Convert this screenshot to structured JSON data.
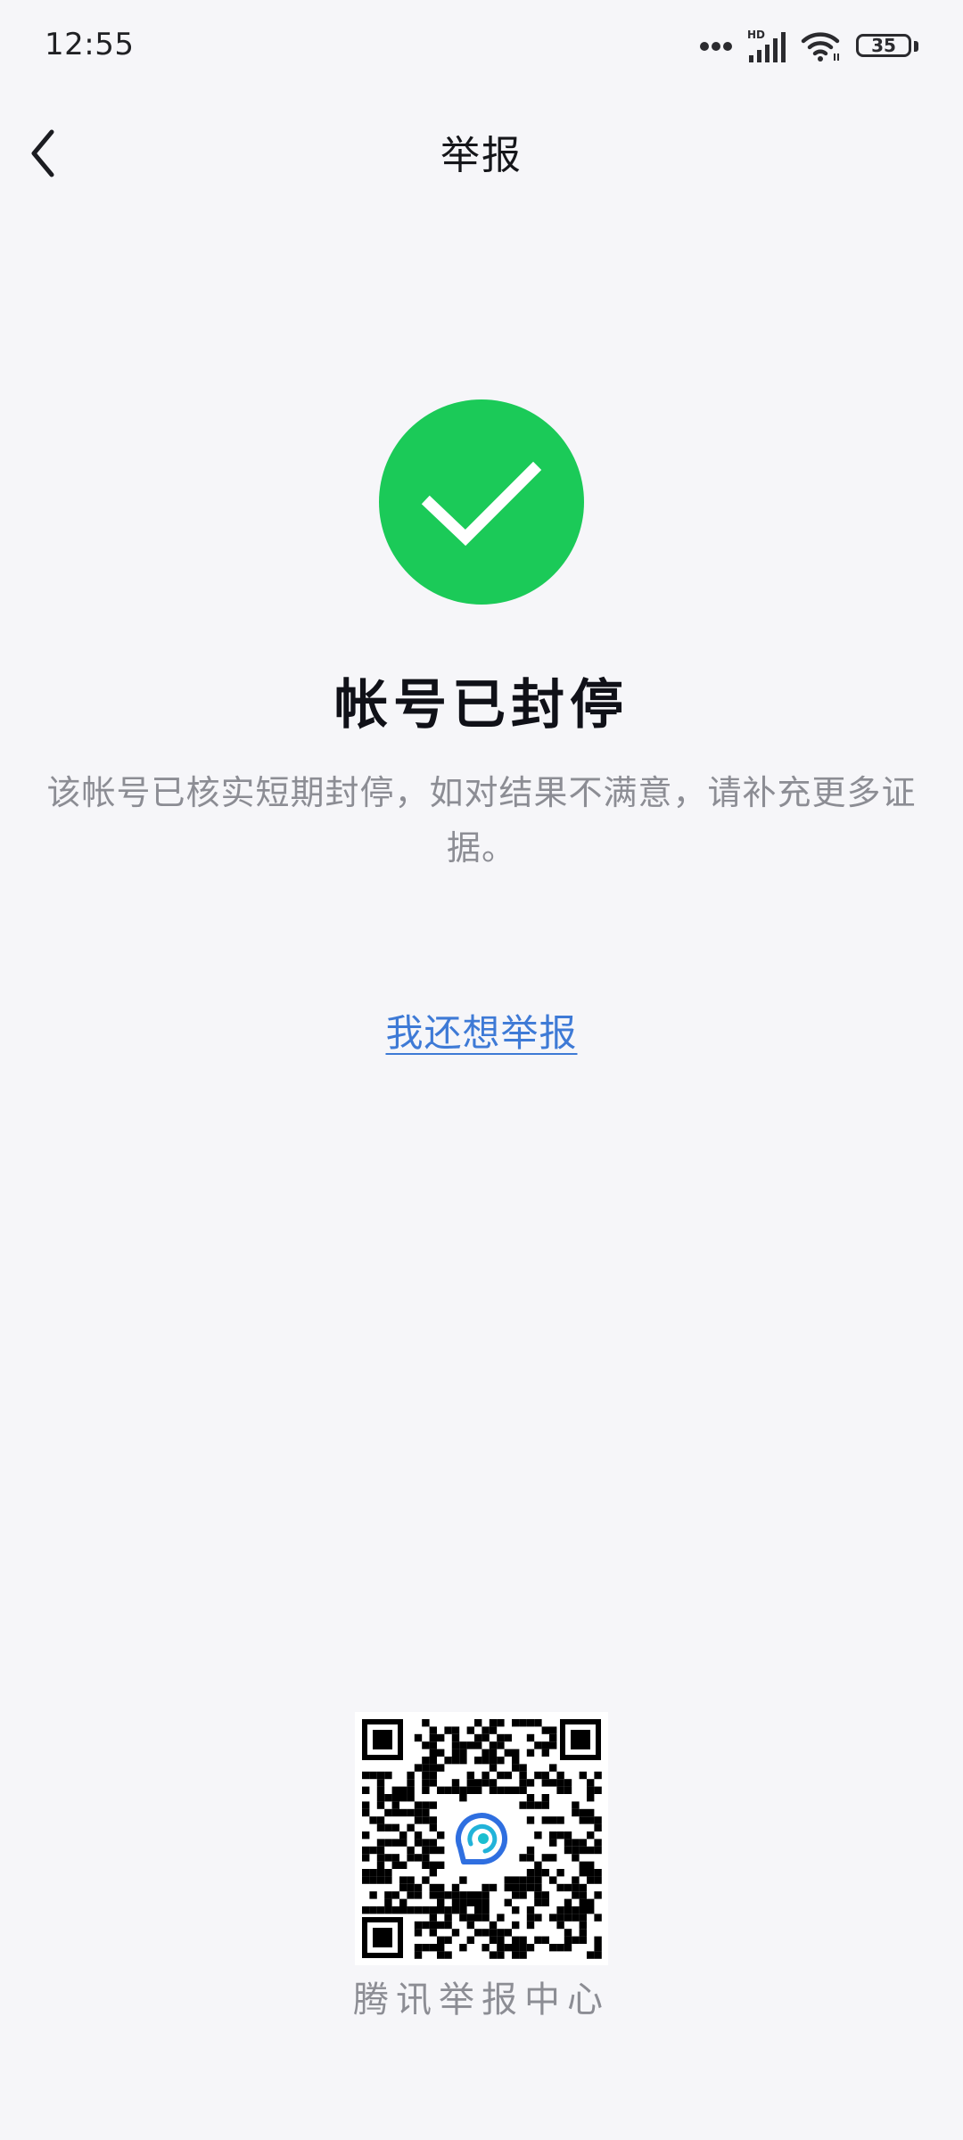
{
  "status_bar": {
    "time": "12:55",
    "network_label": "HD",
    "battery_level": "35",
    "icons": [
      "more-dots-icon",
      "signal-icon",
      "wifi-icon",
      "battery-icon"
    ]
  },
  "header": {
    "title": "举报",
    "back_icon": "chevron-left-icon"
  },
  "result": {
    "status_icon": "check-circle-icon",
    "status_color": "#1bca58",
    "title": "帐号已封停",
    "description": "该帐号已核实短期封停，如对结果不满意，请补充更多证据。"
  },
  "actions": {
    "report_again_label": "我还想举报",
    "link_color": "#3e7ad6"
  },
  "footer": {
    "qr_icon": "qr-code-icon",
    "qr_caption": "腾讯举报中心"
  }
}
